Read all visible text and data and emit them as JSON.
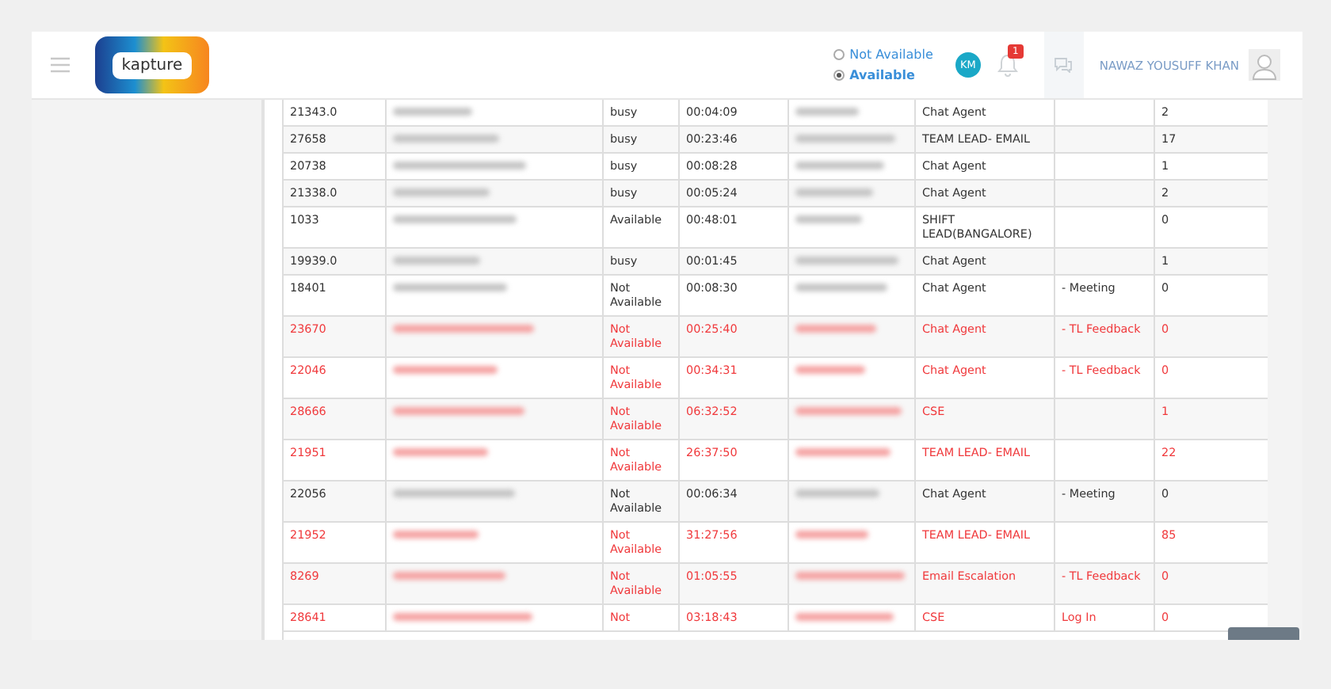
{
  "header": {
    "logo": "kapture",
    "presence": [
      {
        "label": "Not Available",
        "selected": false
      },
      {
        "label": "Available",
        "selected": true
      }
    ],
    "initials": "KM",
    "notification_count": "1",
    "user_name": "NAWAZ YOUSUFF KHAN"
  },
  "table": {
    "rows": [
      {
        "id": "21343.0",
        "status": "busy",
        "duration": "00:04:09",
        "role": "Chat Agent",
        "reason": "",
        "count": "2",
        "alert": false
      },
      {
        "id": "27658",
        "status": "busy",
        "duration": "00:23:46",
        "role": "TEAM LEAD- EMAIL",
        "reason": "",
        "count": "17",
        "alert": false
      },
      {
        "id": "20738",
        "status": "busy",
        "duration": "00:08:28",
        "role": "Chat Agent",
        "reason": "",
        "count": "1",
        "alert": false
      },
      {
        "id": "21338.0",
        "status": "busy",
        "duration": "00:05:24",
        "role": "Chat Agent",
        "reason": "",
        "count": "2",
        "alert": false
      },
      {
        "id": "1033",
        "status": "Available",
        "duration": "00:48:01",
        "role": "SHIFT LEAD(BANGALORE)",
        "reason": "",
        "count": "0",
        "alert": false
      },
      {
        "id": "19939.0",
        "status": "busy",
        "duration": "00:01:45",
        "role": "Chat Agent",
        "reason": "",
        "count": "1",
        "alert": false
      },
      {
        "id": "18401",
        "status": "Not Available",
        "duration": "00:08:30",
        "role": "Chat Agent",
        "reason": "- Meeting",
        "count": "0",
        "alert": false
      },
      {
        "id": "23670",
        "status": "Not Available",
        "duration": "00:25:40",
        "role": "Chat Agent",
        "reason": "- TL Feedback",
        "count": "0",
        "alert": true
      },
      {
        "id": "22046",
        "status": "Not Available",
        "duration": "00:34:31",
        "role": "Chat Agent",
        "reason": "- TL Feedback",
        "count": "0",
        "alert": true
      },
      {
        "id": "28666",
        "status": "Not Available",
        "duration": "06:32:52",
        "role": "CSE",
        "reason": "",
        "count": "1",
        "alert": true
      },
      {
        "id": "21951",
        "status": "Not Available",
        "duration": "26:37:50",
        "role": "TEAM LEAD- EMAIL",
        "reason": "",
        "count": "22",
        "alert": true
      },
      {
        "id": "22056",
        "status": "Not Available",
        "duration": "00:06:34",
        "role": "Chat Agent",
        "reason": "- Meeting",
        "count": "0",
        "alert": false
      },
      {
        "id": "21952",
        "status": "Not Available",
        "duration": "31:27:56",
        "role": "TEAM LEAD- EMAIL",
        "reason": "",
        "count": "85",
        "alert": true
      },
      {
        "id": "8269",
        "status": "Not Available",
        "duration": "01:05:55",
        "role": "Email Escalation",
        "reason": "- TL Feedback",
        "count": "0",
        "alert": true
      },
      {
        "id": "28641",
        "status": "Not",
        "duration": "03:18:43",
        "role": "CSE",
        "reason": "Log In",
        "count": "0",
        "alert": true
      }
    ]
  }
}
